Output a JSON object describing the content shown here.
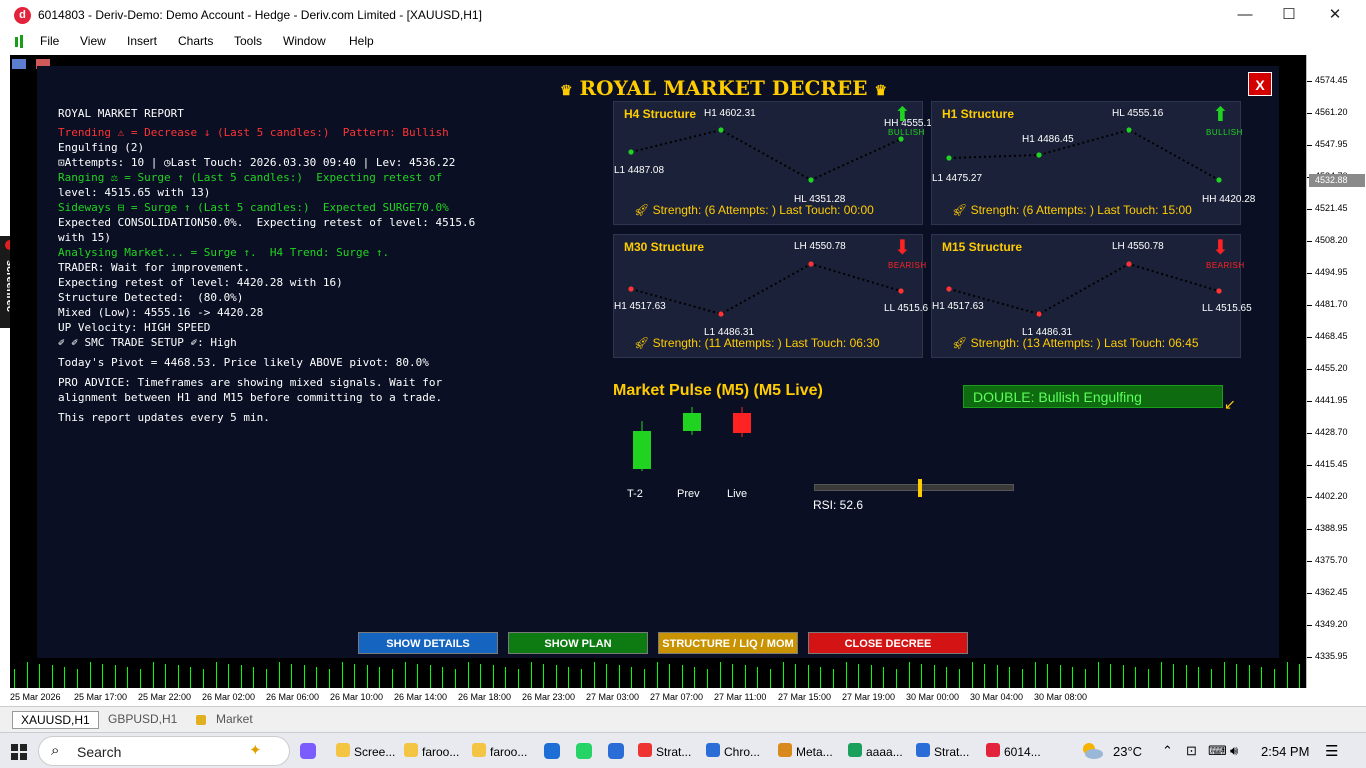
{
  "window": {
    "title": "6014803 - Deriv-Demo: Demo Account - Hedge - Deriv.com Limited - [XAUUSD,H1]",
    "app_icon": "d",
    "minimize": "—",
    "maximize": "☐",
    "close": "✕"
  },
  "menu": [
    "File",
    "View",
    "Insert",
    "Charts",
    "Tools",
    "Window",
    "Help"
  ],
  "price_axis": {
    "labels": [
      "4574.45",
      "4561.20",
      "4547.95",
      "4534.70",
      "4521.45",
      "4508.20",
      "4494.95",
      "4481.70",
      "4468.45",
      "4455.20",
      "4441.95",
      "4428.70",
      "4415.45",
      "4402.20",
      "4388.95",
      "4375.70",
      "4362.45",
      "4349.20",
      "4335.95"
    ],
    "current_price": "4532.88"
  },
  "time_axis": [
    "25 Mar 2026",
    "25 Mar 17:00",
    "25 Mar 22:00",
    "26 Mar 02:00",
    "26 Mar 06:00",
    "26 Mar 10:00",
    "26 Mar 14:00",
    "26 Mar 18:00",
    "26 Mar 23:00",
    "27 Mar 03:00",
    "27 Mar 07:00",
    "27 Mar 11:00",
    "27 Mar 15:00",
    "27 Mar 19:00",
    "30 Mar 00:00",
    "30 Mar 04:00",
    "30 Mar 08:00"
  ],
  "symbol_tabs": [
    "XAUUSD,H1",
    "GBPUSD,H1",
    "Market"
  ],
  "screenrec_label": "screenrec",
  "decree": {
    "title": "ROYAL MARKET DECREE",
    "crown": "♛",
    "close_label": "X",
    "report": {
      "header": "ROYAL MARKET REPORT",
      "lines": [
        {
          "text": "Trending ⚠ = Decrease ↓ (Last 5 candles:)  Pattern: Bullish",
          "color": "red"
        },
        {
          "text": "Engulfing (2)",
          "color": "white"
        },
        {
          "text": "⊡Attempts: 10 | ◷Last Touch: 2026.03.30 09:40 | Lev: 4536.22",
          "color": "white"
        },
        {
          "text": "Ranging ⚖ = Surge ↑ (Last 5 candles:)  Expecting retest of",
          "color": "green"
        },
        {
          "text": "level: 4515.65 with 13)",
          "color": "white"
        },
        {
          "text": "Sideways ⊟ = Surge ↑ (Last 5 candles:)  Expected SURGE70.0%",
          "color": "green"
        },
        {
          "text": "Expected CONSOLIDATION50.0%.  Expecting retest of level: 4515.6",
          "color": "white"
        },
        {
          "text": "with 15)",
          "color": "white"
        },
        {
          "text": "Analysing Market... = Surge ↑.  H4 Trend: Surge ↑.",
          "color": "green"
        },
        {
          "text": "TRADER: Wait for improvement.",
          "color": "white"
        },
        {
          "text": "Expecting retest of level: 4420.28 with 16)",
          "color": "white"
        },
        {
          "text": "Structure Detected:  (80.0%)",
          "color": "white"
        },
        {
          "text": "Mixed (Low): 4555.16 -> 4420.28",
          "color": "white"
        },
        {
          "text": "UP Velocity: HIGH SPEED",
          "color": "white"
        },
        {
          "text": "✐ ✐ SMC TRADE SETUP ✐: High",
          "color": "white"
        },
        {
          "text": "Today's Pivot = 4468.53. Price likely ABOVE pivot: 80.0%",
          "color": "white"
        },
        {
          "text": "PRO ADVICE: Timeframes are showing mixed signals. Wait for",
          "color": "white"
        },
        {
          "text": "alignment between H1 and M15 before committing to a trade.",
          "color": "white"
        },
        {
          "text": "This report updates every 5 min.",
          "color": "white"
        }
      ]
    },
    "cards": [
      {
        "title": "H4 Structure",
        "trend": "BULLISH",
        "arrow": "⬆",
        "color": "#21d321",
        "labels": [
          "L1 4487.08",
          "H1 4602.31",
          "HL 4351.28",
          "HH 4555.1"
        ],
        "strength": "Strength:  (6 Attempts: ) Last Touch:  00:00"
      },
      {
        "title": "H1 Structure",
        "trend": "BULLISH",
        "arrow": "⬆",
        "color": "#21d321",
        "labels": [
          "L1 4475.27",
          "H1 4486.45",
          "HL 4555.16",
          "HH 4420.28"
        ],
        "strength": "Strength:  (6 Attempts: ) Last Touch:  15:00"
      },
      {
        "title": "M30 Structure",
        "trend": "BEARISH",
        "arrow": "⬇",
        "color": "#ff2222",
        "labels": [
          "H1 4517.63",
          "L1 4486.31",
          "LH 4550.78",
          "LL 4515.6"
        ],
        "strength": "Strength:  (11 Attempts: ) Last Touch:  06:30"
      },
      {
        "title": "M15 Structure",
        "trend": "BEARISH",
        "arrow": "⬇",
        "color": "#ff2222",
        "labels": [
          "H1 4517.63",
          "L1 4486.31",
          "LH 4550.78",
          "LL 4515.65"
        ],
        "strength": "Strength:  (13 Attempts: ) Last Touch:  06:45"
      }
    ],
    "pulse": {
      "title": "Market Pulse (M5) (M5 Live)",
      "candles": [
        "T-2",
        "Prev",
        "Live"
      ],
      "pattern": "DOUBLE: Bullish Engulfing",
      "rsi_label": "RSI: 52.6",
      "rsi_value": 52.6
    },
    "buttons": {
      "details": "SHOW DETAILS",
      "plan": "SHOW PLAN",
      "structure": "STRUCTURE / LIQ / MOM",
      "close": "CLOSE DECREE"
    }
  },
  "taskbar": {
    "search": "Search",
    "items": [
      "Scree...",
      "faroo...",
      "faroo...",
      "Strat...",
      "Chro...",
      "Meta...",
      "aaaa...",
      "Strat...",
      "6014..."
    ],
    "temperature": "23°C",
    "time": "2:54 PM"
  }
}
